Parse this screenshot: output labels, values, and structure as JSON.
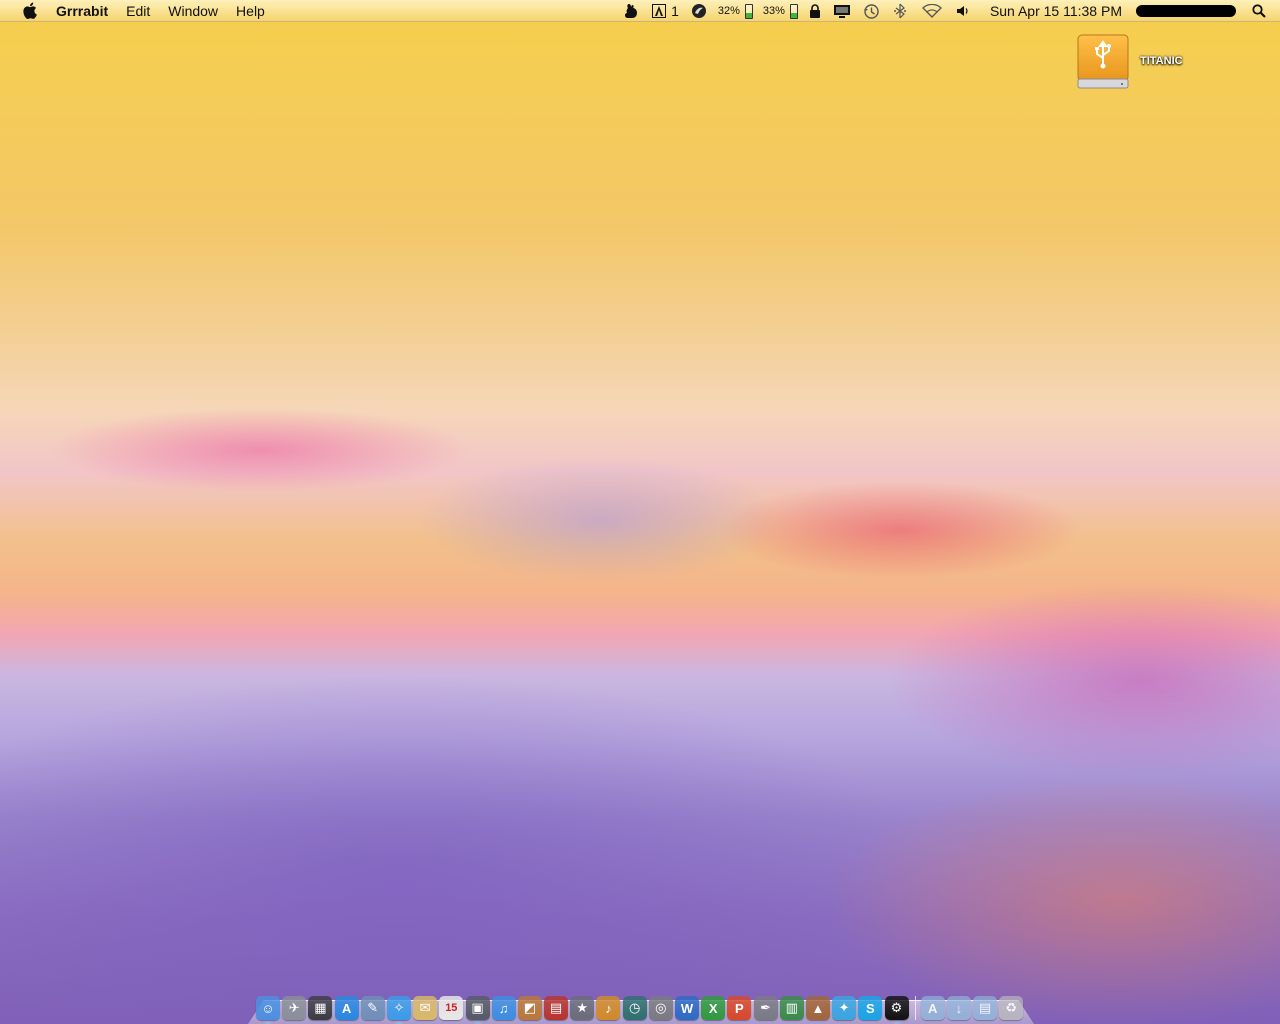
{
  "menubar": {
    "apple_icon": "apple-logo-icon",
    "app_name": "Grrrabit",
    "menus": [
      "Edit",
      "Window",
      "Help"
    ],
    "status": {
      "adobe_count": "1",
      "battery1_percent": "32%",
      "battery1_level": 0.32,
      "battery2_percent": "33%",
      "battery2_level": 0.33,
      "clock": "Sun Apr 15  11:38 PM",
      "icons": [
        "growl-icon",
        "adobe-icon",
        "istat-icon",
        "lock-icon",
        "display-icon",
        "time-machine-icon",
        "bluetooth-icon",
        "wifi-icon",
        "volume-icon",
        "spotlight-icon"
      ]
    }
  },
  "desktop": {
    "drive": {
      "label": "TITANIC",
      "icon": "usb-drive-icon",
      "color": "#f2a526"
    }
  },
  "dock": {
    "items": [
      {
        "name": "finder",
        "glyph": "☺",
        "color": "#4b8fe0",
        "running": true
      },
      {
        "name": "launchpad",
        "glyph": "✈",
        "color": "#8a8f98",
        "running": false
      },
      {
        "name": "mission-control",
        "glyph": "▦",
        "color": "#3c3c44",
        "running": false
      },
      {
        "name": "app-store",
        "glyph": "A",
        "color": "#2a86e0",
        "running": false
      },
      {
        "name": "preview",
        "glyph": "✎",
        "color": "#6f8fb8",
        "running": false
      },
      {
        "name": "safari",
        "glyph": "✧",
        "color": "#3c9be8",
        "running": true
      },
      {
        "name": "notes",
        "glyph": "✉",
        "color": "#d9b86a",
        "running": false
      },
      {
        "name": "ical",
        "glyph": "15",
        "color": "#e8e8e8",
        "running": false
      },
      {
        "name": "preview-photos",
        "glyph": "▣",
        "color": "#555a66",
        "running": true
      },
      {
        "name": "itunes",
        "glyph": "♫",
        "color": "#3d8de0",
        "running": false
      },
      {
        "name": "iphoto",
        "glyph": "◩",
        "color": "#b8783a",
        "running": false
      },
      {
        "name": "photo-booth",
        "glyph": "▤",
        "color": "#b6342e",
        "running": false
      },
      {
        "name": "imovie",
        "glyph": "★",
        "color": "#6b6b7a",
        "running": false
      },
      {
        "name": "garageband",
        "glyph": "♪",
        "color": "#d08a2a",
        "running": false
      },
      {
        "name": "time-machine",
        "glyph": "◷",
        "color": "#2e6f6f",
        "running": false
      },
      {
        "name": "screen-capture",
        "glyph": "◎",
        "color": "#7a7a82",
        "running": false
      },
      {
        "name": "word",
        "glyph": "W",
        "color": "#2d6ac4",
        "running": false
      },
      {
        "name": "excel",
        "glyph": "X",
        "color": "#2f9a3e",
        "running": false
      },
      {
        "name": "powerpoint",
        "glyph": "P",
        "color": "#d8482a",
        "running": false
      },
      {
        "name": "pen-tool",
        "glyph": "✒",
        "color": "#7a7a86",
        "running": false
      },
      {
        "name": "activity-monitor",
        "glyph": "▥",
        "color": "#3a8a4a",
        "running": false
      },
      {
        "name": "keynote",
        "glyph": "▲",
        "color": "#a0653a",
        "running": false
      },
      {
        "name": "twitter",
        "glyph": "✦",
        "color": "#3aa5e0",
        "running": false
      },
      {
        "name": "skype",
        "glyph": "S",
        "color": "#19a4e6",
        "running": false
      },
      {
        "name": "steam",
        "glyph": "⚙",
        "color": "#111111",
        "running": true
      }
    ],
    "stacks": [
      {
        "name": "applications-stack",
        "glyph": "A",
        "color": "#8fb3d8"
      },
      {
        "name": "downloads-stack",
        "glyph": "↓",
        "color": "#8fb3d8"
      },
      {
        "name": "documents-stack",
        "glyph": "▤",
        "color": "#8fb3d8"
      },
      {
        "name": "trash",
        "glyph": "♻",
        "color": "#b8b8bc"
      }
    ]
  }
}
